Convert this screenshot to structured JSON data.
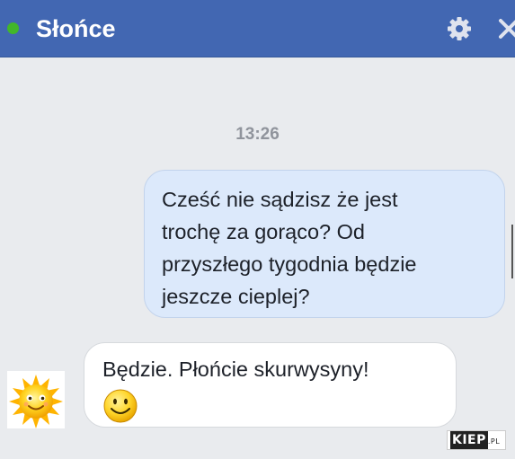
{
  "header": {
    "title": "Słońce",
    "status": "online",
    "icons": [
      "online-status-dot",
      "gear-icon",
      "close-icon"
    ],
    "colors": {
      "bar": "#4267b2",
      "online": "#42b72a"
    }
  },
  "conversation": {
    "timestamp": "13:26",
    "messages": [
      {
        "direction": "outgoing",
        "lines": [
          "Cześć nie sądzisz że jest",
          "trochę za gorąco? Od",
          "przyszłego tygodnia będzie",
          "jeszcze cieplej?"
        ]
      },
      {
        "direction": "incoming",
        "lines": [
          "Będzie. Płońcie skurwysyny!"
        ],
        "emoji": "smiley-emoji-icon",
        "avatar": "sun-avatar-icon"
      }
    ]
  },
  "watermark": {
    "brand": "KIEP",
    "suffix": ".PL"
  }
}
